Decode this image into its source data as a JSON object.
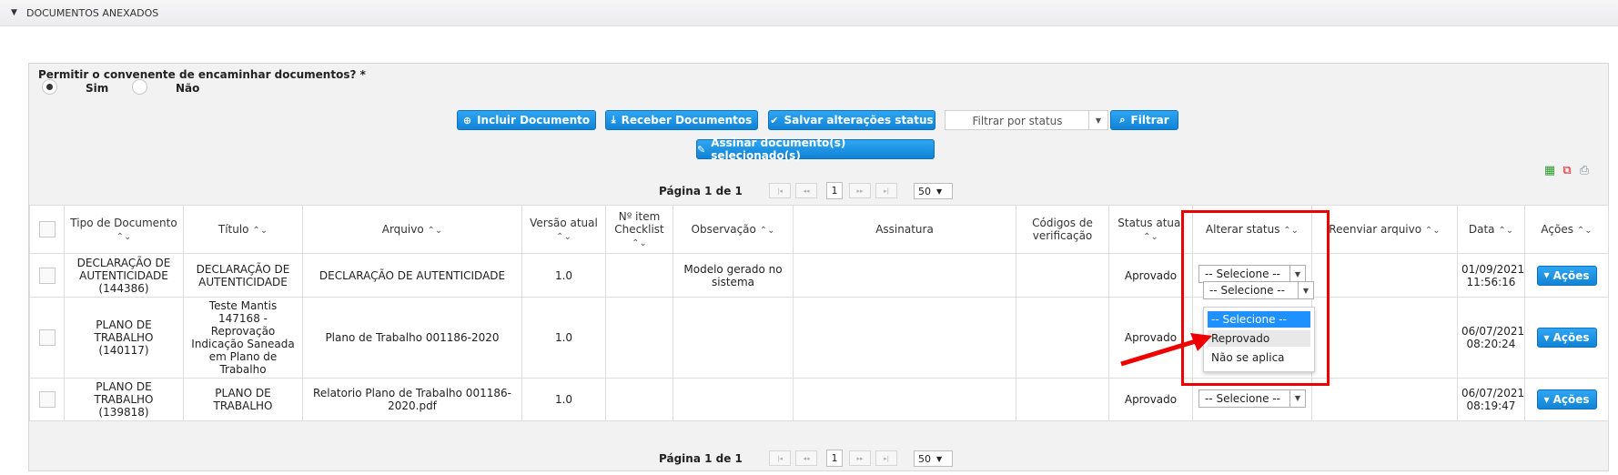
{
  "section": {
    "title": "DOCUMENTOS ANEXADOS"
  },
  "question": {
    "text": "Permitir o convenente de encaminhar documentos? *",
    "options": [
      "Sim",
      "Não"
    ],
    "selected": "Sim"
  },
  "toolbar": {
    "incluir": "Incluir Documento",
    "receber": "Receber Documentos",
    "salvar": "Salvar alterações status",
    "filter_placeholder": "Filtrar por status",
    "filtrar": "Filtrar",
    "assinar": "Assinar documento(s) selecionado(s)"
  },
  "pager": {
    "label": "Página 1 de 1",
    "current_page": "1",
    "page_size": "50"
  },
  "table": {
    "headers": {
      "tipo": "Tipo de Documento",
      "titulo": "Título",
      "arquivo": "Arquivo",
      "versao": "Versão atual",
      "nitem": "Nº item Checklist",
      "obs": "Observação",
      "assinatura": "Assinatura",
      "codigos": "Códigos de verificação",
      "status": "Status atual",
      "alterar": "Alterar status",
      "reenviar": "Reenviar arquivo",
      "data": "Data",
      "acoes": "Ações"
    },
    "rows": [
      {
        "tipo": "DECLARAÇÃO DE AUTENTICIDADE (144386)",
        "titulo": "DECLARAÇÃO DE AUTENTICIDADE",
        "arquivo": "DECLARAÇÃO DE AUTENTICIDADE",
        "versao": "1.0",
        "nitem": "",
        "obs": "Modelo gerado no sistema",
        "assinatura": "",
        "codigos": "",
        "status": "Aprovado",
        "alterar": "-- Selecione --",
        "reenviar": "",
        "data": "01/09/2021 11:56:16",
        "acoes": "Ações"
      },
      {
        "tipo": "PLANO DE TRABALHO (140117)",
        "titulo": "Teste Mantis 147168 - Reprovação Indicação Saneada em Plano de Trabalho",
        "arquivo": "Plano de Trabalho 001186-2020",
        "versao": "1.0",
        "nitem": "",
        "obs": "",
        "assinatura": "",
        "codigos": "",
        "status": "Aprovado",
        "alterar": "",
        "reenviar": "",
        "data": "06/07/2021 08:20:24",
        "acoes": "Ações"
      },
      {
        "tipo": "PLANO DE TRABALHO (139818)",
        "titulo": "PLANO DE TRABALHO",
        "arquivo": "Relatorio Plano de Trabalho 001186-2020.pdf",
        "versao": "1.0",
        "nitem": "",
        "obs": "",
        "assinatura": "",
        "codigos": "",
        "status": "Aprovado",
        "alterar": "-- Selecione --",
        "reenviar": "",
        "data": "06/07/2021 08:19:47",
        "acoes": "Ações"
      }
    ]
  },
  "dropdown": {
    "options": [
      "-- Selecione --",
      "Reprovado",
      "Não se aplica"
    ],
    "selected": "-- Selecione --",
    "hovered": "Reprovado"
  },
  "colors": {
    "accent": "#1a8fe3",
    "highlight": "#ee0000",
    "dropdown_selected": "#1e90ff"
  }
}
